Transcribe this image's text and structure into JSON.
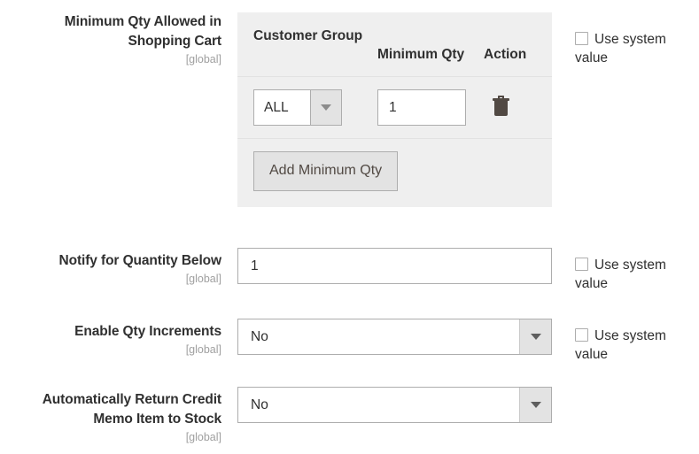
{
  "theme": {
    "text_color": "#303030",
    "scope_color": "#a0a0a0",
    "table_bg": "#efefef",
    "control_border": "#adadad",
    "button_bg": "#e3e3e3",
    "icon_color": "#514943"
  },
  "fields": [
    {
      "id": "min-qty-allowed-in-shopping-cart",
      "label": "Minimum Qty Allowed in Shopping Cart",
      "scope": "[global]",
      "type": "table",
      "table": {
        "columns": [
          "Customer Group",
          "Minimum Qty",
          "Action"
        ],
        "rows": [
          {
            "customer_group": "ALL",
            "minimum_qty": "1",
            "action_icon": "trash-icon"
          }
        ],
        "add_button_label": "Add Minimum Qty"
      },
      "use_system_value": {
        "label": "Use system value",
        "checked": false
      }
    },
    {
      "id": "notify-for-quantity-below",
      "label": "Notify for Quantity Below",
      "scope": "[global]",
      "type": "text",
      "value": "1",
      "use_system_value": {
        "label": "Use system value",
        "checked": false
      }
    },
    {
      "id": "enable-qty-increments",
      "label": "Enable Qty Increments",
      "scope": "[global]",
      "type": "select",
      "value": "No",
      "use_system_value": {
        "label": "Use system value",
        "checked": false
      }
    },
    {
      "id": "automatically-return-credit-memo-item-to-stock",
      "label_line_1": "Automatically Return Credit",
      "label_line_2": "Memo Item to Stock",
      "label": "Automatically Return Credit Memo Item to Stock",
      "scope": "[global]",
      "type": "select",
      "value": "No"
    }
  ]
}
